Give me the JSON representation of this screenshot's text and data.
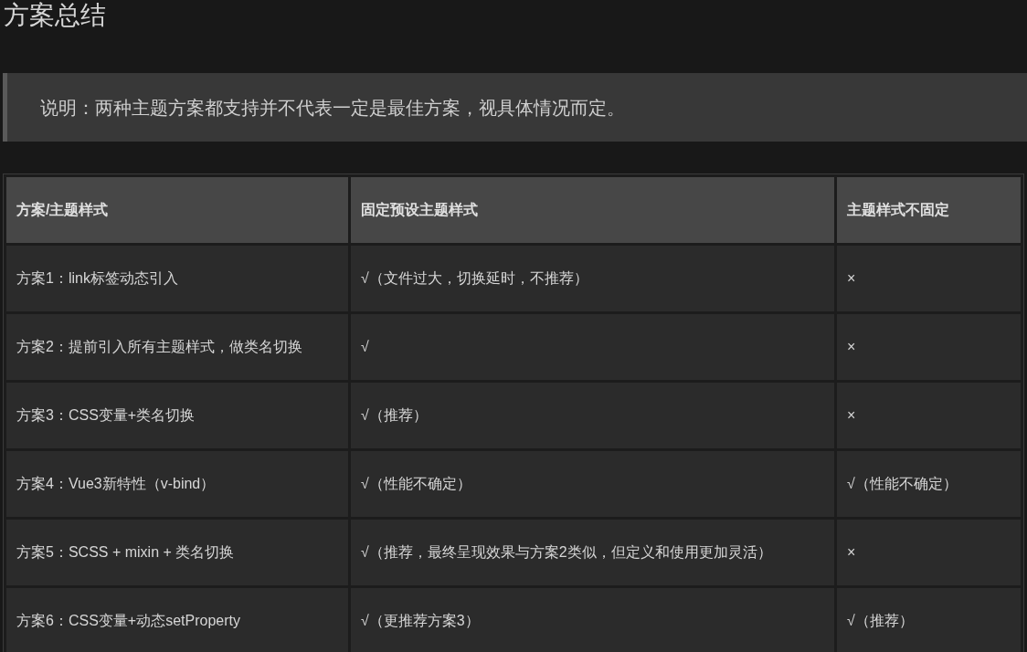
{
  "title": "方案总结",
  "note": "说明：两种主题方案都支持并不代表一定是最佳方案，视具体情况而定。",
  "table": {
    "columns": [
      "方案/主题样式",
      "固定预设主题样式",
      "主题样式不固定"
    ],
    "rows": [
      [
        "方案1：link标签动态引入",
        "√（文件过大，切换延时，不推荐）",
        "×"
      ],
      [
        "方案2：提前引入所有主题样式，做类名切换",
        "√",
        "×"
      ],
      [
        "方案3：CSS变量+类名切换",
        "√（推荐）",
        "×"
      ],
      [
        "方案4：Vue3新特性（v-bind）",
        "√（性能不确定）",
        "√（性能不确定）"
      ],
      [
        "方案5：SCSS + mixin + 类名切换",
        "√（推荐，最终呈现效果与方案2类似，但定义和使用更加灵活）",
        "×"
      ],
      [
        "方案6：CSS变量+动态setProperty",
        "√（更推荐方案3）",
        "√（推荐）"
      ]
    ]
  }
}
